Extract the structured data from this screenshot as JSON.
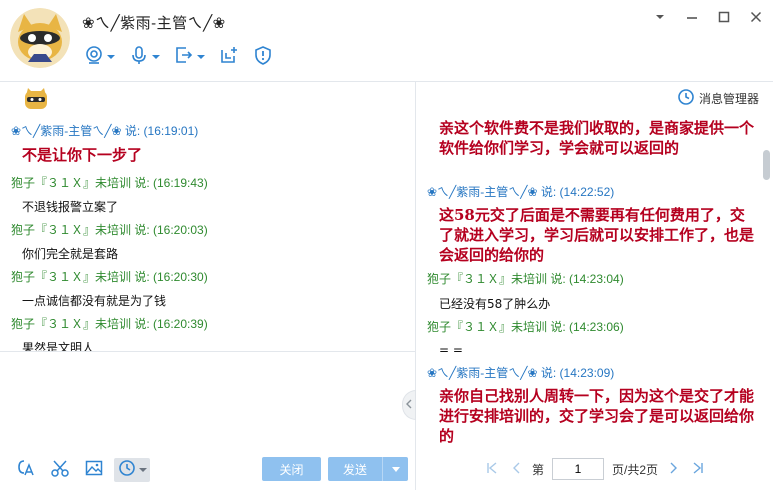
{
  "window": {
    "title": "❀ㄟ╱紫雨-主管ㄟ╱❀"
  },
  "toolbar": {
    "icons": [
      "camera-icon",
      "microphone-icon",
      "screen-share-icon",
      "add-window-icon",
      "shield-icon"
    ]
  },
  "left_messages": [
    {
      "sender": "❀ㄟ╱紫雨-主管ㄟ╱❀ 说: (16:19:01)",
      "text": "不是让你下一步了",
      "highlight": true,
      "sender_color": "blue"
    },
    {
      "sender": "狍子『３１Ｘ』未培训 说: (16:19:43)",
      "text": "不退钱报警立案了",
      "highlight": false,
      "sender_color": "green"
    },
    {
      "sender": "狍子『３１Ｘ』未培训 说: (16:20:03)",
      "text": "你们完全就是套路",
      "highlight": false,
      "sender_color": "green"
    },
    {
      "sender": "狍子『３１Ｘ』未培训 说: (16:20:30)",
      "text": "一点诚信都没有就是为了钱",
      "highlight": false,
      "sender_color": "green"
    },
    {
      "sender": "狍子『３１Ｘ』未培训 说: (16:20:39)",
      "text": "果然是文明人",
      "highlight": false,
      "sender_color": "green"
    }
  ],
  "bottom": {
    "close_label": "关闭",
    "send_label": "发送"
  },
  "right_panel": {
    "manager_label": "消息管理器",
    "messages": [
      {
        "sender": "",
        "text": "亲这个软件费不是我们收取的，是商家提供一个软件给你们学习，学会就可以返回的",
        "highlight": true
      },
      {
        "sender": "❀ㄟ╱紫雨-主管ㄟ╱❀ 说: (14:22:52)",
        "sender_color": "blue",
        "text": "这58元交了后面是不需要再有任何费用了，交了就进入学习，学习后就可以安排工作了，也是会返回的给你的",
        "highlight": true
      },
      {
        "sender": "狍子『３１Ｘ』未培训 说: (14:23:04)",
        "sender_color": "green",
        "text": "已经没有58了肿么办",
        "highlight": false
      },
      {
        "sender": "狍子『３１Ｘ』未培训 说: (14:23:06)",
        "sender_color": "green",
        "text": "= =",
        "highlight": false
      },
      {
        "sender": "❀ㄟ╱紫雨-主管ㄟ╱❀ 说: (14:23:09)",
        "sender_color": "blue",
        "text": "亲你自己找别人周转一下，因为这个是交了才能进行安排培训的，交了学习会了是可以返回给你的",
        "highlight": true
      }
    ],
    "pager": {
      "prefix": "第",
      "page": "1",
      "suffix": "页/共2页"
    }
  },
  "colors": {
    "accent": "#2f84d1",
    "highlight_text": "#b5001f",
    "green_sender": "#2f8a2f",
    "blue_sender": "#2676c2"
  }
}
